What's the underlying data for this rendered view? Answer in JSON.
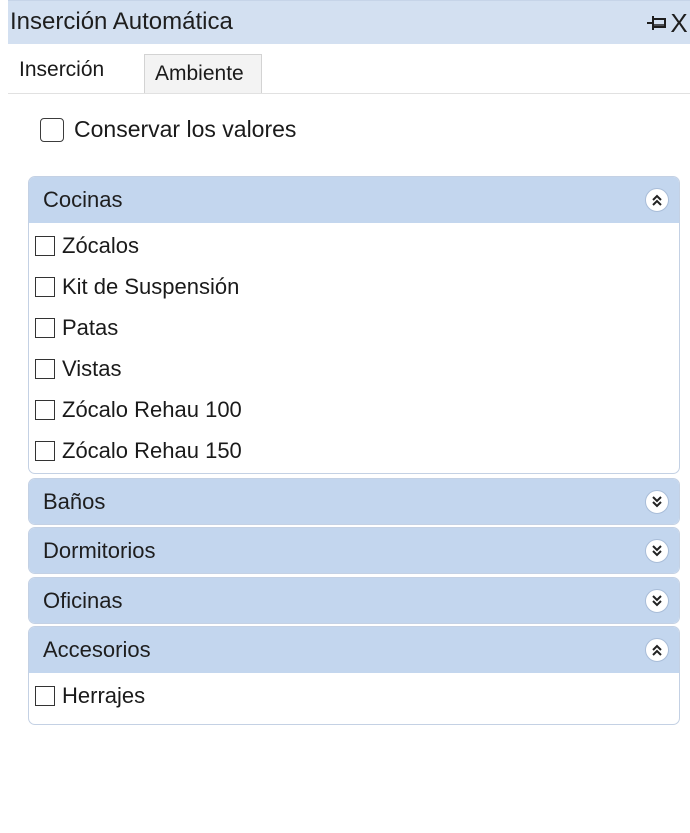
{
  "window": {
    "title": "Inserción Automática",
    "pin_icon": "pin-icon",
    "close_glyph": "X"
  },
  "tabs": [
    {
      "label": "Inserción",
      "active": true
    },
    {
      "label": "Ambiente",
      "active": false
    }
  ],
  "keep_values": {
    "label": "Conservar los valores",
    "checked": false
  },
  "groups": [
    {
      "title": "Cocinas",
      "expanded": true,
      "chevron": "chevron-up-double-icon",
      "items": [
        {
          "label": "Zócalos",
          "checked": false
        },
        {
          "label": "Kit de Suspensión",
          "checked": false
        },
        {
          "label": "Patas",
          "checked": false
        },
        {
          "label": "Vistas",
          "checked": false
        },
        {
          "label": "Zócalo Rehau 100",
          "checked": false
        },
        {
          "label": "Zócalo Rehau 150",
          "checked": false
        }
      ]
    },
    {
      "title": "Baños",
      "expanded": false,
      "chevron": "chevron-down-double-icon",
      "items": []
    },
    {
      "title": "Dormitorios",
      "expanded": false,
      "chevron": "chevron-down-double-icon",
      "items": []
    },
    {
      "title": "Oficinas",
      "expanded": false,
      "chevron": "chevron-down-double-icon",
      "items": []
    },
    {
      "title": "Accesorios",
      "expanded": true,
      "chevron": "chevron-up-double-icon",
      "items": [
        {
          "label": "Herrajes",
          "checked": false
        }
      ]
    }
  ],
  "colors": {
    "title_bar": "#d3e0f1",
    "group_header": "#c3d6ee",
    "group_border": "#c4d1e4"
  }
}
